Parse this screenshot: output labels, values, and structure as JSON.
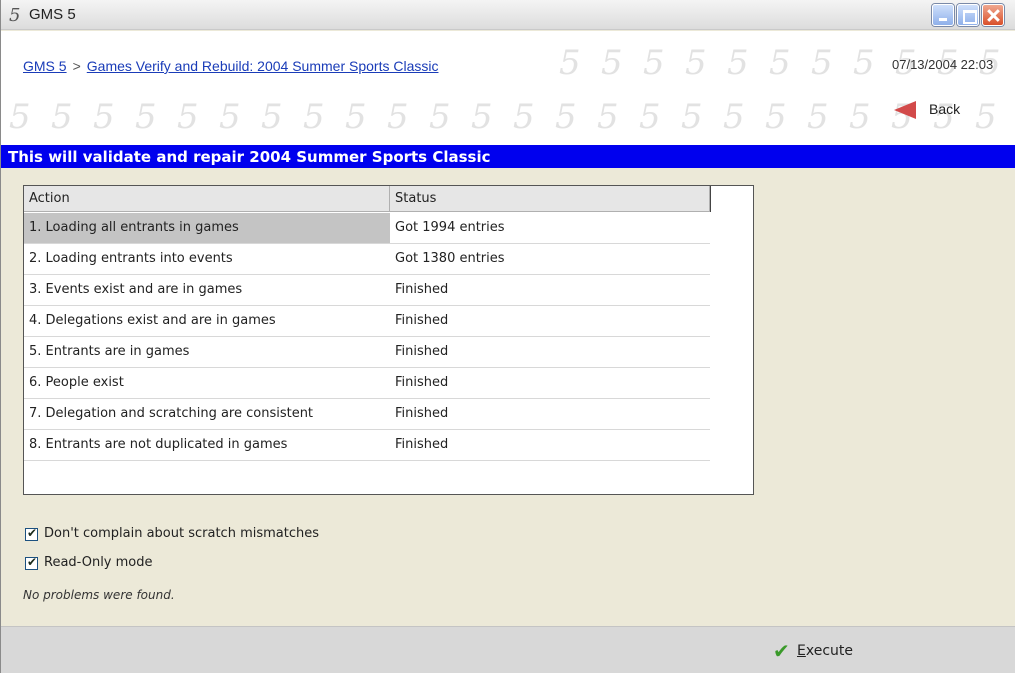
{
  "window": {
    "icon_glyph": "5",
    "title": "GMS 5"
  },
  "header": {
    "breadcrumb_home": "GMS 5",
    "breadcrumb_separator": ">",
    "breadcrumb_page": "Games Verify and Rebuild: 2004 Summer  Sports Classic",
    "timestamp": "07/13/2004 22:03",
    "back_label": "Back"
  },
  "banner": {
    "text": "This will validate and repair 2004 Summer  Sports Classic"
  },
  "table": {
    "columns": [
      "Action",
      "Status"
    ],
    "rows": [
      {
        "action": "1. Loading all entrants in games",
        "status": "Got 1994 entries"
      },
      {
        "action": "2. Loading entrants into events",
        "status": "Got 1380 entries"
      },
      {
        "action": "3. Events exist and are in games",
        "status": "Finished"
      },
      {
        "action": "4. Delegations exist and are in games",
        "status": "Finished"
      },
      {
        "action": "5. Entrants are in games",
        "status": "Finished"
      },
      {
        "action": "6. People exist",
        "status": "Finished"
      },
      {
        "action": "7. Delegation and scratching are consistent",
        "status": "Finished"
      },
      {
        "action": "8. Entrants are not duplicated in games",
        "status": "Finished"
      }
    ]
  },
  "options": {
    "scratch_mismatch_label": "Don't complain about scratch mismatches",
    "scratch_mismatch_checked": true,
    "read_only_label": "Read-Only mode",
    "read_only_checked": true
  },
  "status_message": "No problems were found.",
  "footer": {
    "execute_label": "Execute"
  },
  "colors": {
    "banner": "#0000ee",
    "link": "#1a3cb8",
    "back_arrow": "#d24a4a",
    "execute_check": "#3a9a2a"
  },
  "icons": {
    "app": "gms-logo-icon",
    "back": "back-arrow-icon",
    "execute": "checkmark-icon"
  }
}
